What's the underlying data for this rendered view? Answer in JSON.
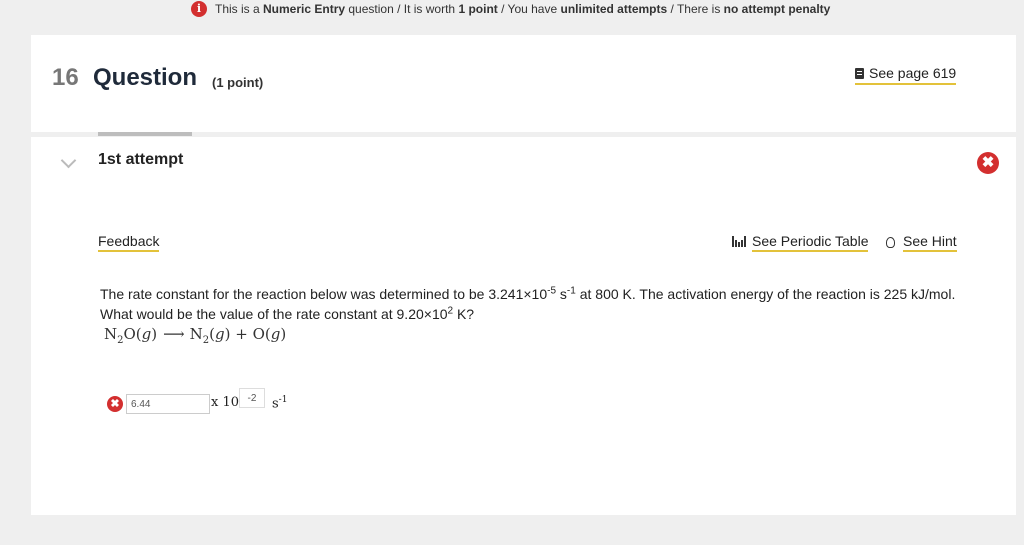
{
  "info_bar": {
    "p1": "This is a ",
    "b1": "Numeric Entry",
    "p2": " question / It is worth ",
    "b2": "1 point",
    "p3": " / You have ",
    "b3": "unlimited attempts",
    "p4": " / There is ",
    "b4": "no attempt penalty",
    "icon_glyph": "i"
  },
  "question": {
    "number": "16",
    "title": "Question",
    "points": "(1 point)",
    "see_page": "See page 619"
  },
  "attempt": {
    "label": "1st attempt",
    "close_glyph": "✖"
  },
  "links": {
    "feedback": "Feedback",
    "periodic": "See Periodic Table",
    "hint": "See Hint"
  },
  "body": {
    "t1": "The rate constant for the reaction below was determined to be 3.241×10",
    "s1": "-5",
    "t2": " s",
    "s2": "-1",
    "t3": " at 800 K. The activation energy of the reaction is 225  kJ/mol. What would be the value of the rate constant at 9.20×10",
    "s3": "2",
    "t4": " K?"
  },
  "equation": {
    "r1": "N",
    "r1_sub": "2",
    "r1b": "O(",
    "g1": "g",
    "r1c": ")",
    "arrow": "⟶",
    "p1": "N",
    "p1_sub": "2",
    "p1b": "(",
    "g2": "g",
    "p1c": ") + O(",
    "g3": "g",
    "p1d": ")"
  },
  "answer": {
    "mantissa": "6.44",
    "times": "x 10",
    "exponent": "-2",
    "unit": "s",
    "unit_exp": "-1",
    "status_glyph": "✖"
  },
  "colors": {
    "accent_underline": "#e3c23a",
    "error_red": "#d32f2f"
  }
}
